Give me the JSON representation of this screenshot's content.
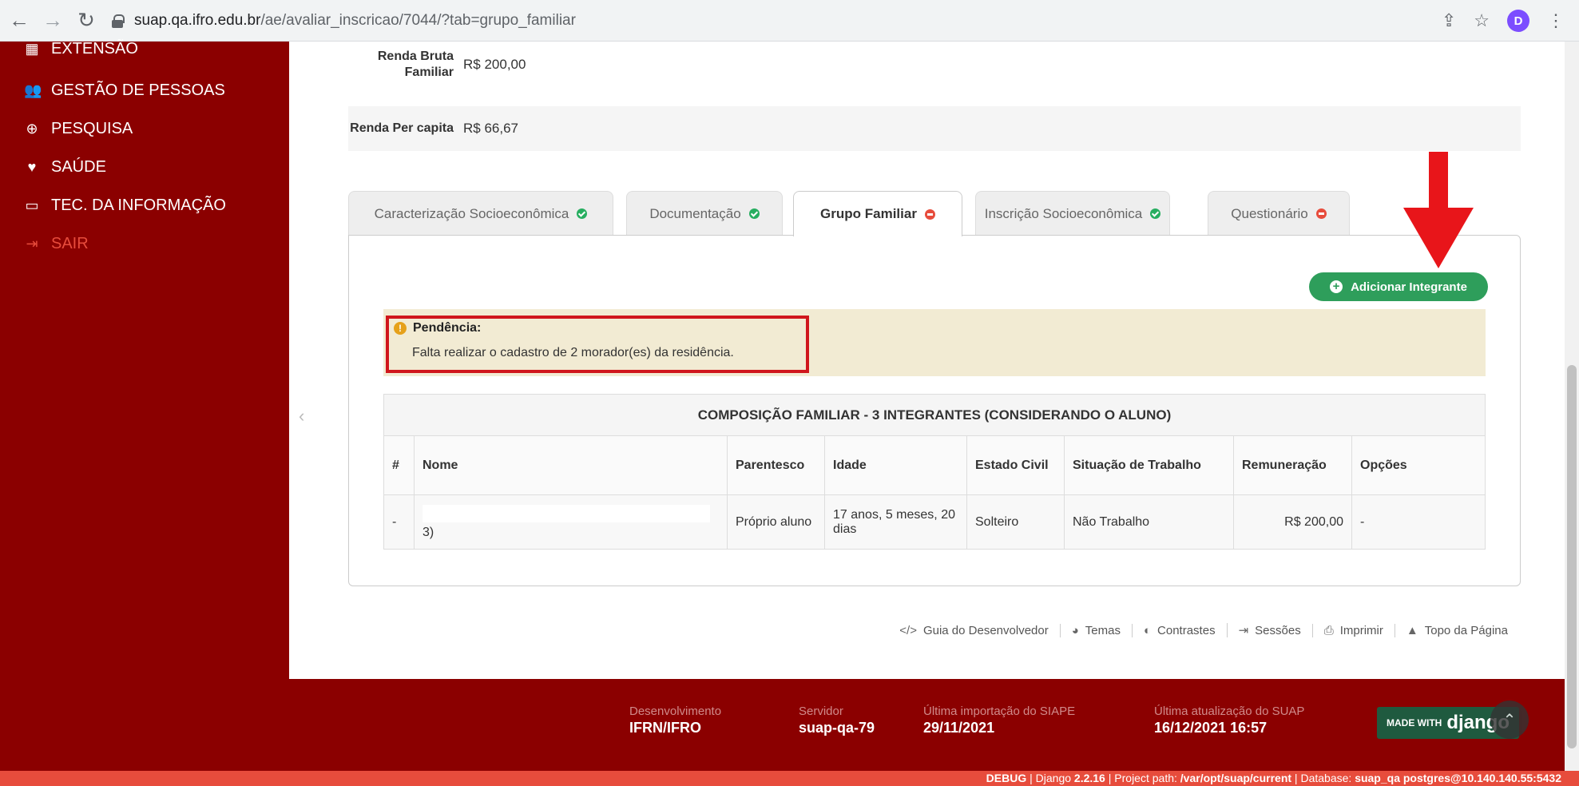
{
  "browser": {
    "url_host": "suap.qa.ifro.edu.br",
    "url_path": "/ae/avaliar_inscricao/7044/?tab=grupo_familiar",
    "avatar_letter": "D"
  },
  "sidebar": {
    "items": [
      {
        "label": "EXTENSÃO",
        "icon": "extension-icon"
      },
      {
        "label": "GESTÃO DE PESSOAS",
        "icon": "users-icon"
      },
      {
        "label": "PESQUISA",
        "icon": "globe-icon"
      },
      {
        "label": "SAÚDE",
        "icon": "heart-icon"
      },
      {
        "label": "TEC. DA INFORMAÇÃO",
        "icon": "laptop-icon"
      },
      {
        "label": "SAIR",
        "icon": "logout-icon"
      }
    ]
  },
  "info": {
    "renda_bruta_label": "Renda Bruta Familiar",
    "renda_bruta_value": "R$ 200,00",
    "renda_per_label": "Renda Per capita",
    "renda_per_value": "R$ 66,67"
  },
  "tabs": [
    {
      "label": "Caracterização Socioeconômica",
      "status": "ok"
    },
    {
      "label": "Documentação",
      "status": "ok"
    },
    {
      "label": "Grupo Familiar",
      "status": "pending",
      "active": true
    },
    {
      "label": "Inscrição Socioeconômica",
      "status": "ok"
    },
    {
      "label": "Questionário",
      "status": "pending"
    }
  ],
  "add_button": "Adicionar Integrante",
  "alert": {
    "title": "Pendência:",
    "text": "Falta realizar o cadastro de 2 morador(es) da residência."
  },
  "table": {
    "caption": "COMPOSIÇÃO FAMILIAR - 3 INTEGRANTES (CONSIDERANDO O ALUNO)",
    "headers": [
      "#",
      "Nome",
      "Parentesco",
      "Idade",
      "Estado Civil",
      "Situação de Trabalho",
      "Remuneração",
      "Opções"
    ],
    "rows": [
      [
        "-",
        "3)",
        "Próprio aluno",
        "17 anos, 5 meses, 20 dias",
        "Solteiro",
        "Não Trabalho",
        "R$ 200,00",
        "-"
      ]
    ]
  },
  "footer_links": [
    {
      "label": "Guia do Desenvolvedor",
      "icon": "code-icon"
    },
    {
      "label": "Temas",
      "icon": "palette-icon"
    },
    {
      "label": "Contrastes",
      "icon": "contrast-icon"
    },
    {
      "label": "Sessões",
      "icon": "sessions-icon"
    },
    {
      "label": "Imprimir",
      "icon": "print-icon"
    },
    {
      "label": "Topo da Página",
      "icon": "caret-up-icon"
    }
  ],
  "footer": {
    "env_label": "Desenvolvimento",
    "env_value": "IFRN/IFRO",
    "server_label": "Servidor",
    "server_value": "suap-qa-79",
    "siape_label": "Última importação do SIAPE",
    "siape_value": "29/11/2021",
    "suap_label": "Última atualização do SUAP",
    "suap_value": "16/12/2021 16:57",
    "django_small": "MADE WITH",
    "django_big": "django"
  },
  "debug": {
    "label": "DEBUG",
    "django": "Django",
    "django_version": "2.2.16",
    "path_label": "Project path:",
    "path": "/var/opt/suap/current",
    "db_label": "Database:",
    "db": "suap_qa postgres@10.140.140.55:5432"
  },
  "colors": {
    "sidebar": "#8b0000",
    "accent_green": "#2e9e5b",
    "alert_bg": "#f2ebd3",
    "highlight_red": "#d0161c"
  }
}
